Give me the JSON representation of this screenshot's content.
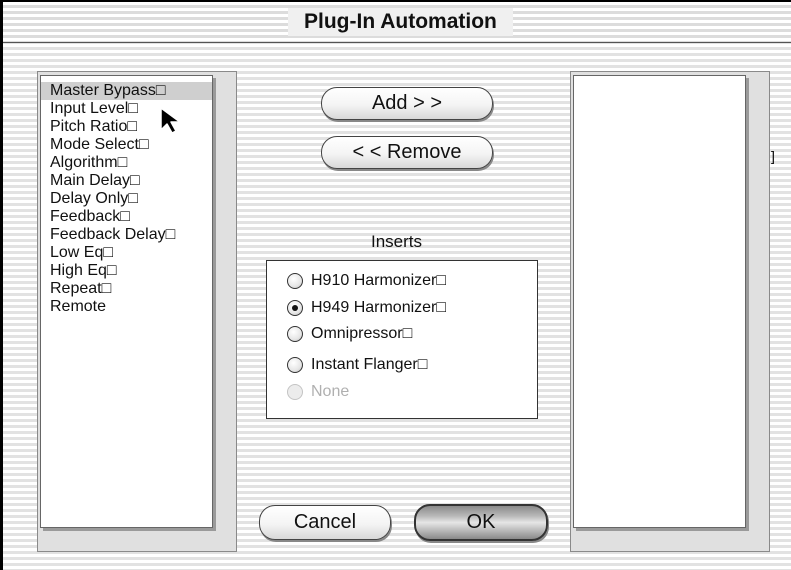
{
  "window": {
    "title": "Plug-In Automation"
  },
  "parameters": {
    "items": [
      {
        "label": "Master Bypass□"
      },
      {
        "label": "Input Level□"
      },
      {
        "label": "Pitch Ratio□"
      },
      {
        "label": "Mode Select□"
      },
      {
        "label": "Algorithm□"
      },
      {
        "label": "Main Delay□"
      },
      {
        "label": "Delay Only□"
      },
      {
        "label": "Feedback□"
      },
      {
        "label": "Feedback Delay□"
      },
      {
        "label": "Low Eq□"
      },
      {
        "label": "High Eq□"
      },
      {
        "label": "Repeat□"
      },
      {
        "label": "Remote"
      }
    ],
    "selected": "Master Bypass□"
  },
  "buttons": {
    "add": "Add > >",
    "remove": "< < Remove",
    "cancel": "Cancel",
    "ok": "OK"
  },
  "inserts": {
    "label": "Inserts",
    "options": [
      {
        "label": "H910 Harmonizer□"
      },
      {
        "label": "H949 Harmonizer□"
      },
      {
        "label": "Omnipressor□"
      },
      {
        "label": "Instant Flanger□"
      },
      {
        "label": "None"
      }
    ],
    "selected": "H949 Harmonizer□",
    "disabled": "None"
  },
  "stray_glyph": "]"
}
